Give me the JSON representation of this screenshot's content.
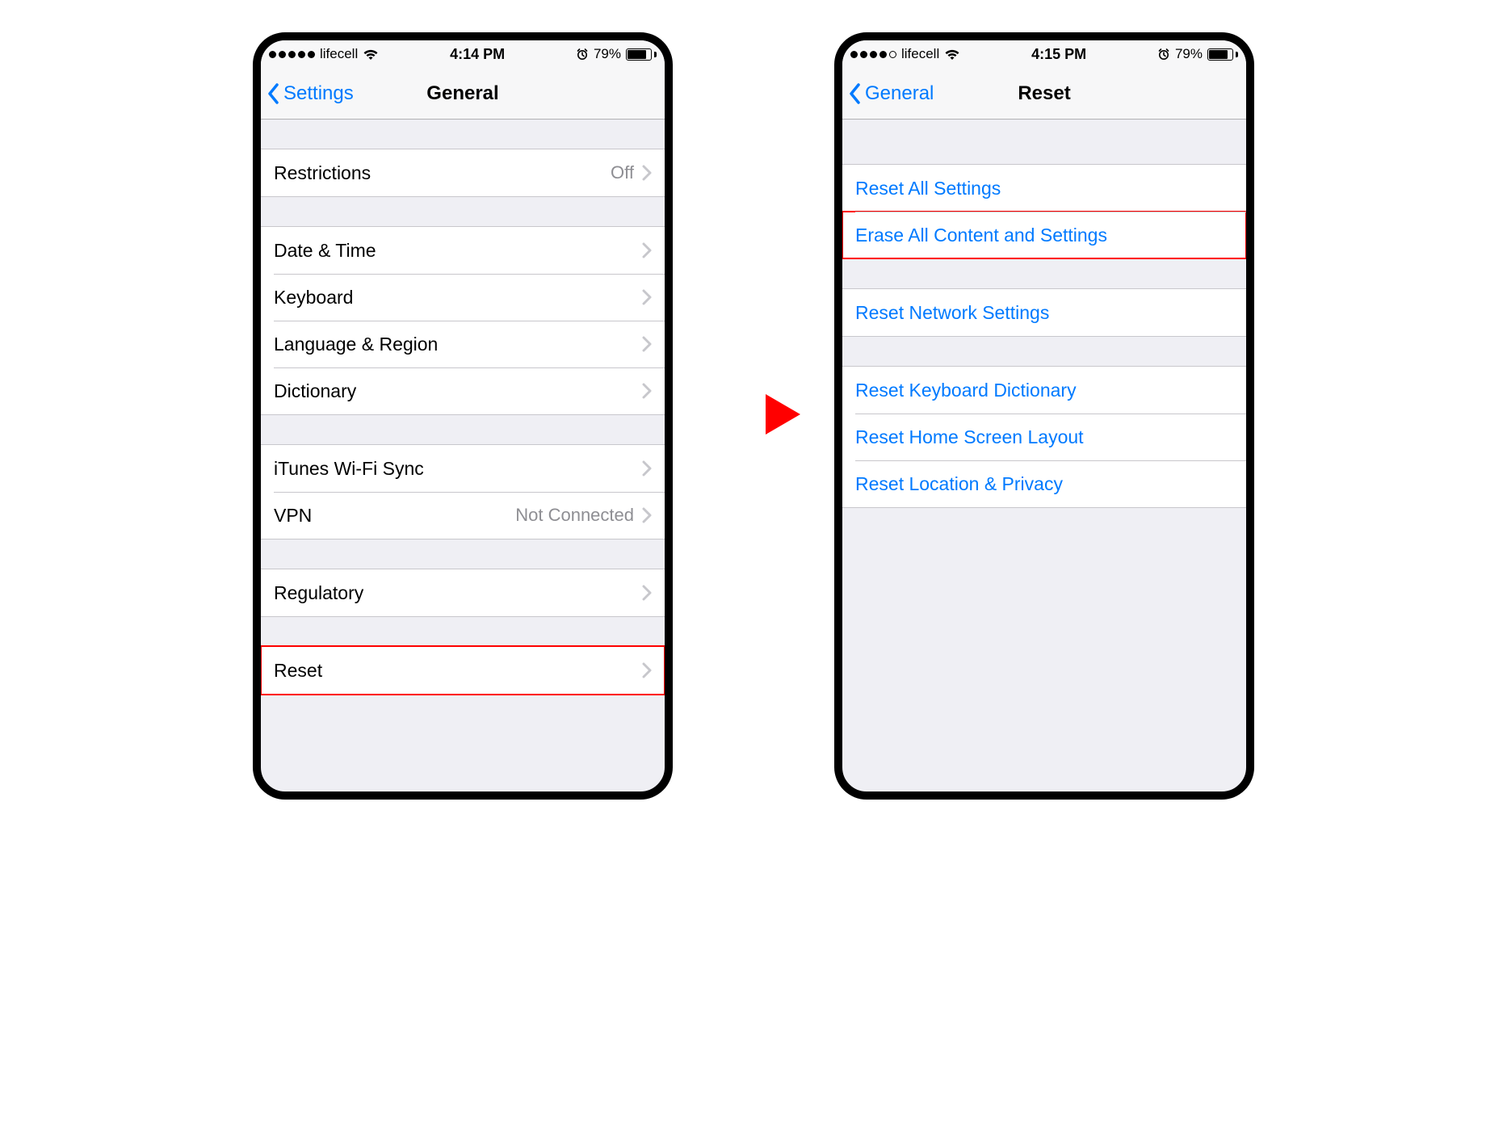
{
  "left": {
    "statusbar": {
      "signal_dots": [
        "filled",
        "filled",
        "filled",
        "filled",
        "filled"
      ],
      "carrier": "lifecell",
      "time": "4:14 PM",
      "battery_pct": "79%"
    },
    "nav": {
      "back": "Settings",
      "title": "General"
    },
    "groups": [
      {
        "rows": [
          {
            "name": "restrictions",
            "label": "Restrictions",
            "value": "Off",
            "chevron": true
          }
        ]
      },
      {
        "rows": [
          {
            "name": "date-time",
            "label": "Date & Time",
            "chevron": true
          },
          {
            "name": "keyboard",
            "label": "Keyboard",
            "chevron": true
          },
          {
            "name": "language-region",
            "label": "Language & Region",
            "chevron": true
          },
          {
            "name": "dictionary",
            "label": "Dictionary",
            "chevron": true
          }
        ]
      },
      {
        "rows": [
          {
            "name": "itunes-wifi-sync",
            "label": "iTunes Wi-Fi Sync",
            "chevron": true
          },
          {
            "name": "vpn",
            "label": "VPN",
            "value": "Not Connected",
            "chevron": true
          }
        ]
      },
      {
        "rows": [
          {
            "name": "regulatory",
            "label": "Regulatory",
            "chevron": true
          }
        ]
      },
      {
        "rows": [
          {
            "name": "reset",
            "label": "Reset",
            "chevron": true,
            "highlight": true
          }
        ]
      }
    ]
  },
  "right": {
    "statusbar": {
      "signal_dots": [
        "filled",
        "filled",
        "filled",
        "filled",
        "empty"
      ],
      "carrier": "lifecell",
      "time": "4:15 PM",
      "battery_pct": "79%"
    },
    "nav": {
      "back": "General",
      "title": "Reset"
    },
    "groups": [
      {
        "rows": [
          {
            "name": "reset-all-settings",
            "label": "Reset All Settings",
            "blue": true
          },
          {
            "name": "erase-all-content-and-settings",
            "label": "Erase All Content and Settings",
            "blue": true,
            "highlight": true
          }
        ]
      },
      {
        "rows": [
          {
            "name": "reset-network-settings",
            "label": "Reset Network Settings",
            "blue": true
          }
        ]
      },
      {
        "rows": [
          {
            "name": "reset-keyboard-dictionary",
            "label": "Reset Keyboard Dictionary",
            "blue": true
          },
          {
            "name": "reset-home-screen-layout",
            "label": "Reset Home Screen Layout",
            "blue": true
          },
          {
            "name": "reset-location-privacy",
            "label": "Reset Location & Privacy",
            "blue": true
          }
        ]
      }
    ]
  }
}
